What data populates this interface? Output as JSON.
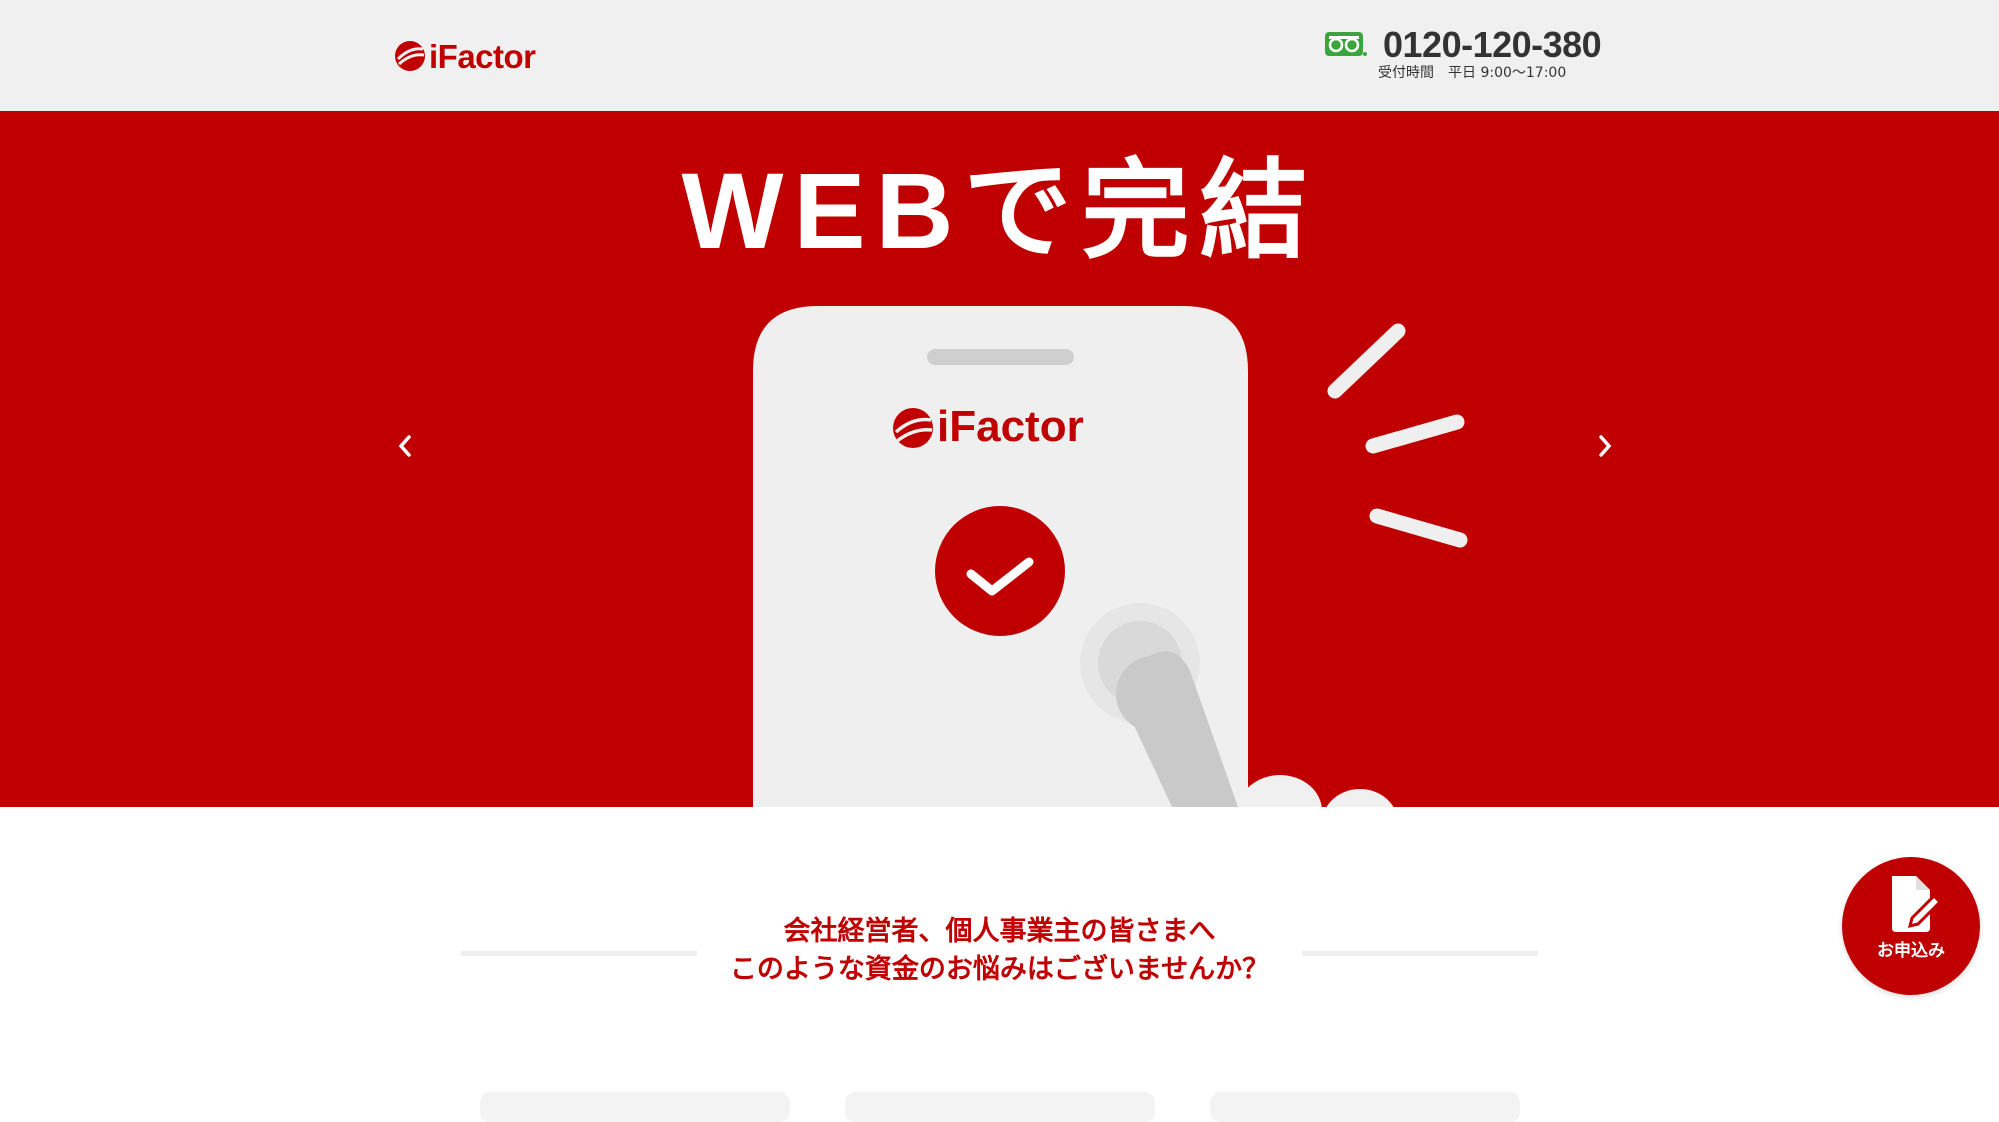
{
  "header": {
    "logo_text": "iFactor",
    "phone_number": "0120-120-380",
    "phone_hours": "受付時間　平日 9:00〜17:00"
  },
  "hero": {
    "title": "WEBで完結",
    "phone_logo_text": "iFactor",
    "prev_icon": "chevron-left-icon",
    "next_icon": "chevron-right-icon"
  },
  "section": {
    "heading_line1": "会社経営者、個人事業主の皆さまへ",
    "heading_line2": "このような資金のお悩みはございませんか？"
  },
  "floating": {
    "apply_label": "お申込み",
    "apply_icon": "document-pen-icon"
  },
  "colors": {
    "brand_red": "#c00000",
    "header_bg": "#f0f0f0",
    "freedial_green": "#3aa53a"
  }
}
